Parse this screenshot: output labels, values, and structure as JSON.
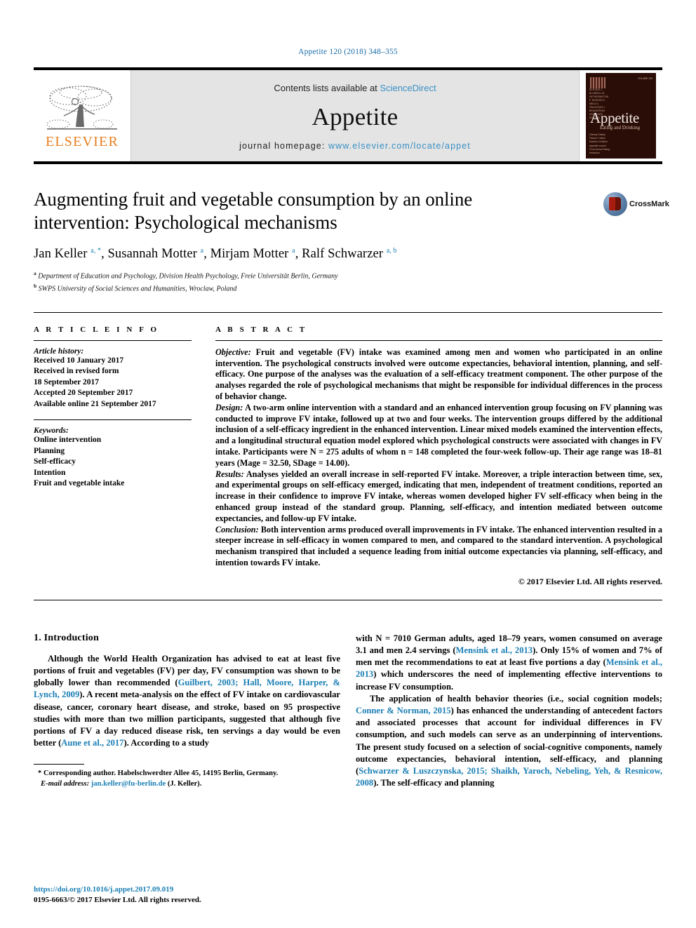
{
  "running_head": "Appetite 120 (2018) 348–355",
  "masthead": {
    "publisher_logo_text": "ELSEVIER",
    "contents_prefix": "Contents lists available at ",
    "contents_link": "ScienceDirect",
    "journal_name": "Appetite",
    "homepage_label": "journal homepage: ",
    "homepage_url": "www.elsevier.com/locate/appet",
    "cover": {
      "title": "Appetite",
      "subtitle": "Eating and Drinking",
      "corner_label": "VOLUME 120",
      "side_list": "EDITORS\nJ. BLUNDELL\nM. HETHERINGTON\nP. ROGERS\nD. MELA\nG. FINLAYSON\nJ. BRUNSTROM\nASSOCIATE EDITORS",
      "bottom_list": "Obesity\nSatiety\nFlavour\nCulture\nNutrition\nChildren\nAppetite control\nFood choice\nEating behaviour"
    }
  },
  "article": {
    "title": "Augmenting fruit and vegetable consumption by an online intervention: Psychological mechanisms",
    "authors_html": "Jan Keller <sup>a, *</sup>, Susannah Motter <sup>a</sup>, Mirjam Motter <sup>a</sup>, Ralf Schwarzer <sup>a, b</sup>",
    "affiliations": [
      {
        "mark": "a",
        "text": "Department of Education and Psychology, Division Health Psychology, Freie Universität Berlin, Germany"
      },
      {
        "mark": "b",
        "text": "SWPS University of Social Sciences and Humanities, Wroclaw, Poland"
      }
    ],
    "crossmark_label": "CrossMark"
  },
  "article_info": {
    "heading": "A R T I C L E  I N F O",
    "history_label": "Article history:",
    "history": [
      "Received 10 January 2017",
      "Received in revised form",
      "18 September 2017",
      "Accepted 20 September 2017",
      "Available online 21 September 2017"
    ],
    "keywords_label": "Keywords:",
    "keywords": [
      "Online intervention",
      "Planning",
      "Self-efficacy",
      "Intention",
      "Fruit and vegetable intake"
    ]
  },
  "abstract": {
    "heading": "A B S T R A C T",
    "objective_label": "Objective:",
    "objective_text": " Fruit and vegetable (FV) intake was examined among men and women who participated in an online intervention. The psychological constructs involved were outcome expectancies, behavioral intention, planning, and self-efficacy. One purpose of the analyses was the evaluation of a self-efficacy treatment component. The other purpose of the analyses regarded the role of psychological mechanisms that might be responsible for individual differences in the process of behavior change.",
    "design_label": "Design:",
    "design_text": " A two-arm online intervention with a standard and an enhanced intervention group focusing on FV planning was conducted to improve FV intake, followed up at two and four weeks. The intervention groups differed by the additional inclusion of a self-efficacy ingredient in the enhanced intervention. Linear mixed models examined the intervention effects, and a longitudinal structural equation model explored which psychological constructs were associated with changes in FV intake. Participants were N = 275 adults of whom n = 148 completed the four-week follow-up. Their age range was 18–81 years (Mage = 32.50, SDage = 14.00).",
    "results_label": "Results:",
    "results_text": " Analyses yielded an overall increase in self-reported FV intake. Moreover, a triple interaction between time, sex, and experimental groups on self-efficacy emerged, indicating that men, independent of treatment conditions, reported an increase in their confidence to improve FV intake, whereas women developed higher FV self-efficacy when being in the enhanced group instead of the standard group. Planning, self-efficacy, and intention mediated between outcome expectancies, and follow-up FV intake.",
    "conclusion_label": "Conclusion:",
    "conclusion_text": " Both intervention arms produced overall improvements in FV intake. The enhanced intervention resulted in a steeper increase in self-efficacy in women compared to men, and compared to the standard intervention. A psychological mechanism transpired that included a sequence leading from initial outcome expectancies via planning, self-efficacy, and intention towards FV intake.",
    "copyright": "© 2017 Elsevier Ltd. All rights reserved."
  },
  "body": {
    "section_number_title": "1. Introduction",
    "left_paragraph_1_parts": {
      "a": "Although the World Health Organization has advised to eat at least five portions of fruit and vegetables (FV) per day, FV consumption was shown to be globally lower than recommended (",
      "ref1": "Guilbert, 2003; Hall, Moore, Harper, & Lynch, 2009",
      "b": "). A recent meta-analysis on the effect of FV intake on cardiovascular disease, cancer, coronary heart disease, and stroke, based on 95 prospective studies with more than two million participants, suggested that although five portions of FV a day reduced disease risk, ten servings a day would be even better (",
      "ref2": "Aune et al., 2017",
      "c": "). According to a study"
    },
    "right_paragraph_1_parts": {
      "a": "with N = 7010 German adults, aged 18–79 years, women consumed on average 3.1 and men 2.4 servings (",
      "ref1": "Mensink et al., 2013",
      "b": "). Only 15% of women and 7% of men met the recommendations to eat at least five portions a day (",
      "ref2": "Mensink et al., 2013",
      "c": ") which underscores the need of implementing effective interventions to increase FV consumption."
    },
    "right_paragraph_2_parts": {
      "a": "The application of health behavior theories (i.e., social cognition models; ",
      "ref1": "Conner & Norman, 2015",
      "b": ") has enhanced the understanding of antecedent factors and associated processes that account for individual differences in FV consumption, and such models can serve as an underpinning of interventions. The present study focused on a selection of social-cognitive components, namely outcome expectancies, behavioral intention, self-efficacy, and planning (",
      "ref2": "Schwarzer & Luszczynska, 2015; Shaikh, Yaroch, Nebeling, Yeh, & Resnicow, 2008",
      "c": "). The self-efficacy and planning"
    }
  },
  "footnotes": {
    "corresponding_marker": "*",
    "corresponding_text": " Corresponding author. Habelschwerdter Allee 45, 14195 Berlin, Germany.",
    "email_label": "E-mail address:",
    "email_value": " jan.keller@fu-berlin.de",
    "email_owner": " (J. Keller)."
  },
  "page_footer": {
    "doi": "https://doi.org/10.1016/j.appet.2017.09.019",
    "issn_copyright": "0195-6663/© 2017 Elsevier Ltd. All rights reserved."
  },
  "colors": {
    "link_blue": "#1b7fb5",
    "elsevier_orange": "#E87F20",
    "masthead_grey": "#e4e4e4"
  }
}
